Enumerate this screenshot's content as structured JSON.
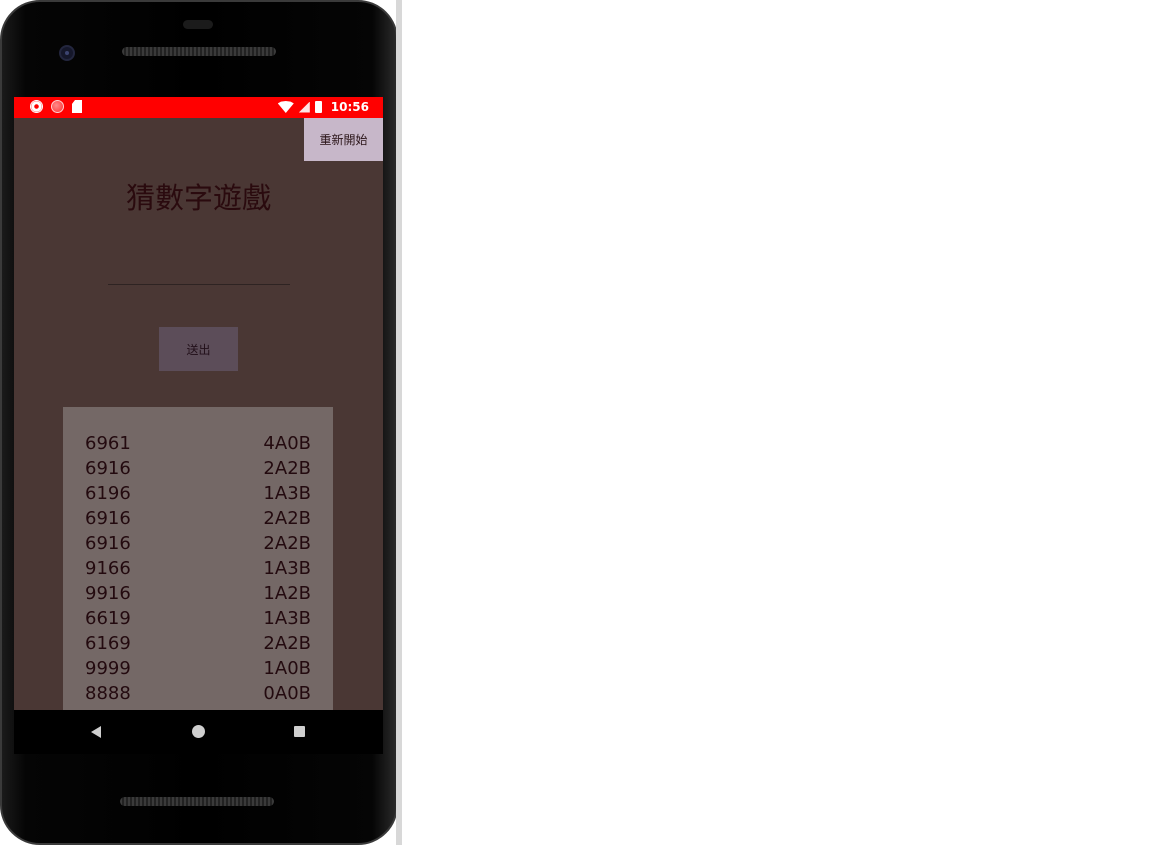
{
  "status_bar": {
    "time": "10:56",
    "left_icons": [
      "settings-icon",
      "record-icon",
      "sdcard-icon"
    ],
    "right_icons": [
      "wifi-icon",
      "signal-icon",
      "battery-icon"
    ],
    "background_color": "#ff0000"
  },
  "app": {
    "restart_label": "重新開始",
    "title": "猜數字遊戲",
    "guess_input_value": "",
    "guess_input_placeholder": "",
    "submit_label": "送出",
    "background_color": "#4a3734"
  },
  "history": [
    {
      "guess": "6961",
      "result": "4A0B"
    },
    {
      "guess": "6916",
      "result": "2A2B"
    },
    {
      "guess": "6196",
      "result": "1A3B"
    },
    {
      "guess": "6916",
      "result": "2A2B"
    },
    {
      "guess": "6916",
      "result": "2A2B"
    },
    {
      "guess": "9166",
      "result": "1A3B"
    },
    {
      "guess": "9916",
      "result": "1A2B"
    },
    {
      "guess": "6619",
      "result": "1A3B"
    },
    {
      "guess": "6169",
      "result": "2A2B"
    },
    {
      "guess": "9999",
      "result": "1A0B"
    },
    {
      "guess": "8888",
      "result": "0A0B"
    }
  ],
  "nav_bar": {
    "icons": [
      "back-icon",
      "home-icon",
      "recents-icon"
    ]
  }
}
